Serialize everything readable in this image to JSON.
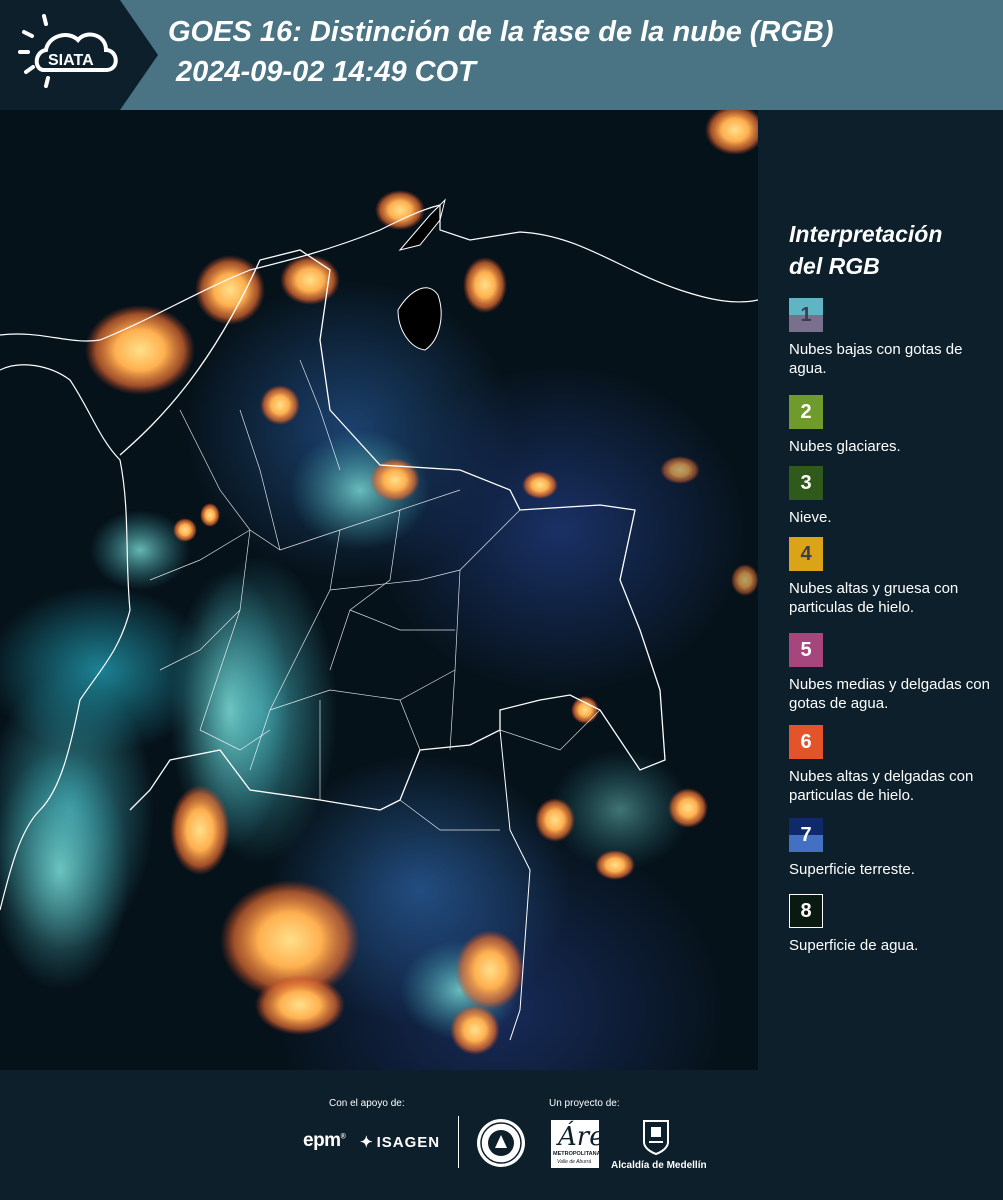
{
  "header": {
    "logo_text": "SIATA",
    "title": "GOES 16: Distinción de la fase de la nube (RGB)",
    "subtitle": "2024-09-02 14:49 COT"
  },
  "map": {
    "region": "Colombia",
    "imagery": "cloud-phase-rgb"
  },
  "legend": {
    "title_line1": "Interpretación",
    "title_line2": "del RGB",
    "items": [
      {
        "number": "1",
        "label": "Nubes bajas con gotas de agua.",
        "color_top": "#5fb5c4",
        "color_bottom": "#7a6f8c",
        "number_color": "#3c3c50"
      },
      {
        "number": "2",
        "label": "Nubes glaciares.",
        "color": "#6f9a2c",
        "number_color": "#ffffff"
      },
      {
        "number": "3",
        "label": "Nieve.",
        "color": "#2f5a1c",
        "number_color": "#ffffff"
      },
      {
        "number": "4",
        "label": "Nubes altas y gruesa con particulas de hielo.",
        "color": "#dba318",
        "number_color": "#3c3c50"
      },
      {
        "number": "5",
        "label": "Nubes medias y delgadas con gotas de agua.",
        "color": "#a5477d",
        "number_color": "#ffffff"
      },
      {
        "number": "6",
        "label": "Nubes altas y delgadas con particulas de hielo.",
        "color": "#e4542b",
        "number_color": "#ffffff"
      },
      {
        "number": "7",
        "label": "Superficie terreste.",
        "color_top": "#0f2a6a",
        "color_bottom": "#4470c4",
        "number_color": "#ffffff"
      },
      {
        "number": "8",
        "label": "Superficie de agua.",
        "color": "#0a1a10",
        "number_color": "#ffffff"
      }
    ]
  },
  "footer": {
    "support_label": "Con el apoyo de:",
    "project_label": "Un proyecto de:",
    "sponsor_epm": "epm",
    "sponsor_isagen": "ISAGEN",
    "area_logo": "Área",
    "area_line1": "METROPOLITANA",
    "area_line2": "Valle de Aburrá",
    "alcaldia": "Alcaldía de Medellín"
  }
}
